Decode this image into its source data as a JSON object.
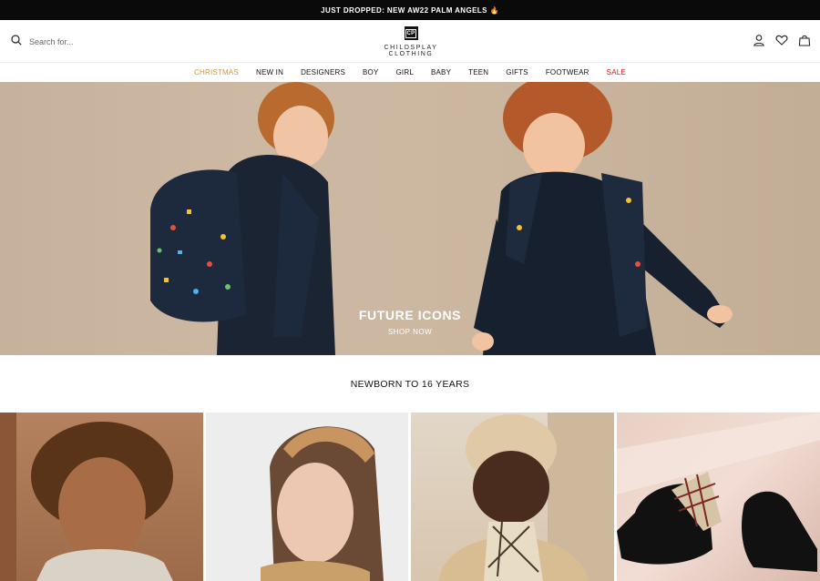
{
  "announcement": "JUST DROPPED: NEW AW22 PALM ANGELS 🔥",
  "search": {
    "placeholder": "Search for..."
  },
  "logo": {
    "mark": "CP",
    "text": "CHILDSPLAY CLOTHING"
  },
  "header_icons": [
    "account-icon",
    "wishlist-heart-icon",
    "bag-icon"
  ],
  "nav": [
    {
      "label": "CHRISTMAS",
      "color": "#c99a3a"
    },
    {
      "label": "NEW IN"
    },
    {
      "label": "DESIGNERS"
    },
    {
      "label": "BOY"
    },
    {
      "label": "GIRL"
    },
    {
      "label": "BABY"
    },
    {
      "label": "TEEN"
    },
    {
      "label": "GIFTS"
    },
    {
      "label": "FOOTWEAR"
    },
    {
      "label": "SALE",
      "color": "#d11a1a"
    }
  ],
  "hero": {
    "title": "FUTURE ICONS",
    "cta": "SHOP NOW"
  },
  "section": {
    "title": "NEWBORN TO 16 YEARS"
  },
  "colors": {
    "announcement_bg": "#0a0a0a",
    "hero_bg": "#c8b49e"
  }
}
